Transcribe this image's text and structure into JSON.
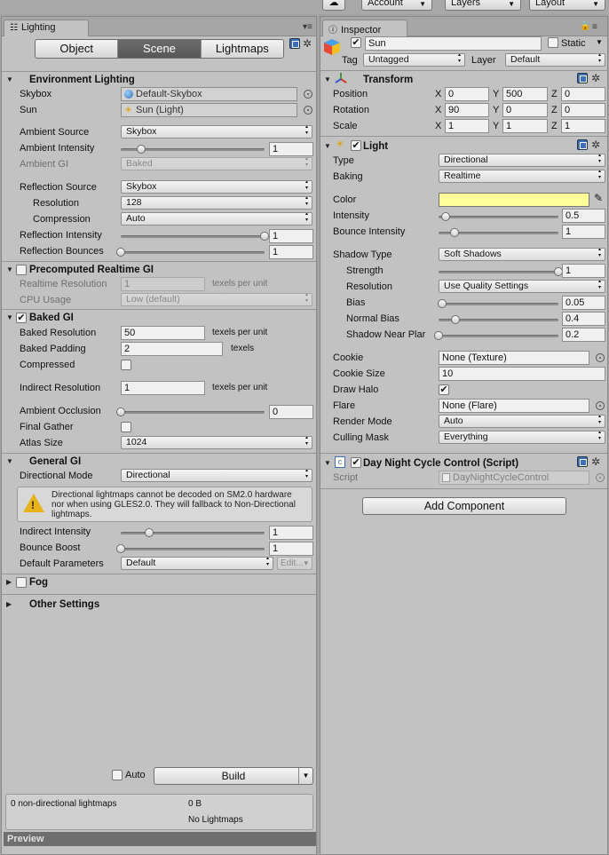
{
  "toolbar": {
    "account": "Account",
    "layers": "Layers",
    "layout": "Layout"
  },
  "lighting": {
    "tab": "Lighting",
    "modes": [
      "Object",
      "Scene",
      "Lightmaps"
    ],
    "env": {
      "title": "Environment Lighting",
      "skybox_label": "Skybox",
      "skybox_value": "Default-Skybox",
      "sun_label": "Sun",
      "sun_value": "Sun (Light)",
      "ambient_source_label": "Ambient Source",
      "ambient_source_value": "Skybox",
      "ambient_intensity_label": "Ambient Intensity",
      "ambient_intensity_value": "1",
      "ambient_intensity_fraction": 0.14,
      "ambient_gi_label": "Ambient GI",
      "ambient_gi_value": "Baked",
      "reflection_source_label": "Reflection Source",
      "reflection_source_value": "Skybox",
      "resolution_label": "Resolution",
      "resolution_value": "128",
      "compression_label": "Compression",
      "compression_value": "Auto",
      "reflection_intensity_label": "Reflection Intensity",
      "reflection_intensity_value": "1",
      "reflection_intensity_fraction": 1.0,
      "reflection_bounces_label": "Reflection Bounces",
      "reflection_bounces_value": "1",
      "reflection_bounces_fraction": 0.0
    },
    "precomputed": {
      "title": "Precomputed Realtime GI",
      "realtime_resolution_label": "Realtime Resolution",
      "realtime_resolution_value": "1",
      "realtime_resolution_unit": "texels per unit",
      "cpu_usage_label": "CPU Usage",
      "cpu_usage_value": "Low (default)"
    },
    "baked": {
      "title": "Baked GI",
      "baked_resolution_label": "Baked Resolution",
      "baked_resolution_value": "50",
      "baked_resolution_unit": "texels per unit",
      "baked_padding_label": "Baked Padding",
      "baked_padding_value": "2",
      "baked_padding_unit": "texels",
      "compressed_label": "Compressed",
      "indirect_resolution_label": "Indirect Resolution",
      "indirect_resolution_value": "1",
      "indirect_resolution_unit": "texels per unit",
      "ambient_occlusion_label": "Ambient Occlusion",
      "ambient_occlusion_value": "0",
      "ambient_occlusion_fraction": 0.0,
      "final_gather_label": "Final Gather",
      "atlas_size_label": "Atlas Size",
      "atlas_size_value": "1024"
    },
    "general": {
      "title": "General GI",
      "directional_mode_label": "Directional Mode",
      "directional_mode_value": "Directional",
      "warning": "Directional lightmaps cannot be decoded on SM2.0 hardware nor when using GLES2.0. They will fallback to Non-Directional lightmaps.",
      "indirect_intensity_label": "Indirect Intensity",
      "indirect_intensity_value": "1",
      "indirect_intensity_fraction": 0.2,
      "bounce_boost_label": "Bounce Boost",
      "bounce_boost_value": "1",
      "bounce_boost_fraction": 0.0,
      "default_parameters_label": "Default Parameters",
      "default_parameters_value": "Default",
      "edit_label": "Edit..."
    },
    "fog": {
      "title": "Fog"
    },
    "other": {
      "title": "Other Settings"
    },
    "auto_label": "Auto",
    "build_label": "Build",
    "status": {
      "lightmaps": "0 non-directional lightmaps",
      "size": "0 B",
      "no_lightmaps": "No Lightmaps"
    },
    "preview": "Preview"
  },
  "inspector": {
    "tab": "Inspector",
    "object_name": "Sun",
    "static_label": "Static",
    "tag_label": "Tag",
    "tag_value": "Untagged",
    "layer_label": "Layer",
    "layer_value": "Default",
    "transform": {
      "title": "Transform",
      "position_label": "Position",
      "position": [
        "0",
        "500",
        "0"
      ],
      "rotation_label": "Rotation",
      "rotation": [
        "90",
        "0",
        "0"
      ],
      "scale_label": "Scale",
      "scale": [
        "1",
        "1",
        "1"
      ],
      "axes": [
        "X",
        "Y",
        "Z"
      ]
    },
    "light": {
      "title": "Light",
      "type_label": "Type",
      "type_value": "Directional",
      "baking_label": "Baking",
      "baking_value": "Realtime",
      "color_label": "Color",
      "color_value": "#ffff99",
      "intensity_label": "Intensity",
      "intensity_value": "0.5",
      "intensity_fraction": 0.06,
      "bounce_label": "Bounce Intensity",
      "bounce_value": "1",
      "bounce_fraction": 0.13,
      "shadow_type_label": "Shadow Type",
      "shadow_type_value": "Soft Shadows",
      "strength_label": "Strength",
      "strength_value": "1",
      "strength_fraction": 1.0,
      "shadow_resolution_label": "Resolution",
      "shadow_resolution_value": "Use Quality Settings",
      "bias_label": "Bias",
      "bias_value": "0.05",
      "bias_fraction": 0.03,
      "normal_bias_label": "Normal Bias",
      "normal_bias_value": "0.4",
      "normal_bias_fraction": 0.14,
      "near_plane_label": "Shadow Near Plar",
      "near_plane_value": "0.2",
      "near_plane_fraction": 0.0,
      "cookie_label": "Cookie",
      "cookie_value": "None (Texture)",
      "cookie_size_label": "Cookie Size",
      "cookie_size_value": "10",
      "draw_halo_label": "Draw Halo",
      "flare_label": "Flare",
      "flare_value": "None (Flare)",
      "render_mode_label": "Render Mode",
      "render_mode_value": "Auto",
      "culling_mask_label": "Culling Mask",
      "culling_mask_value": "Everything"
    },
    "script": {
      "title": "Day Night Cycle Control (Script)",
      "script_label": "Script",
      "script_value": "DayNightCycleControl"
    },
    "add_component": "Add Component"
  },
  "colors": {
    "panel": "#c2c2c2",
    "accent_selected": "#5f5f5f",
    "light_color": "#ffff99",
    "warning": "#e8b31a"
  }
}
